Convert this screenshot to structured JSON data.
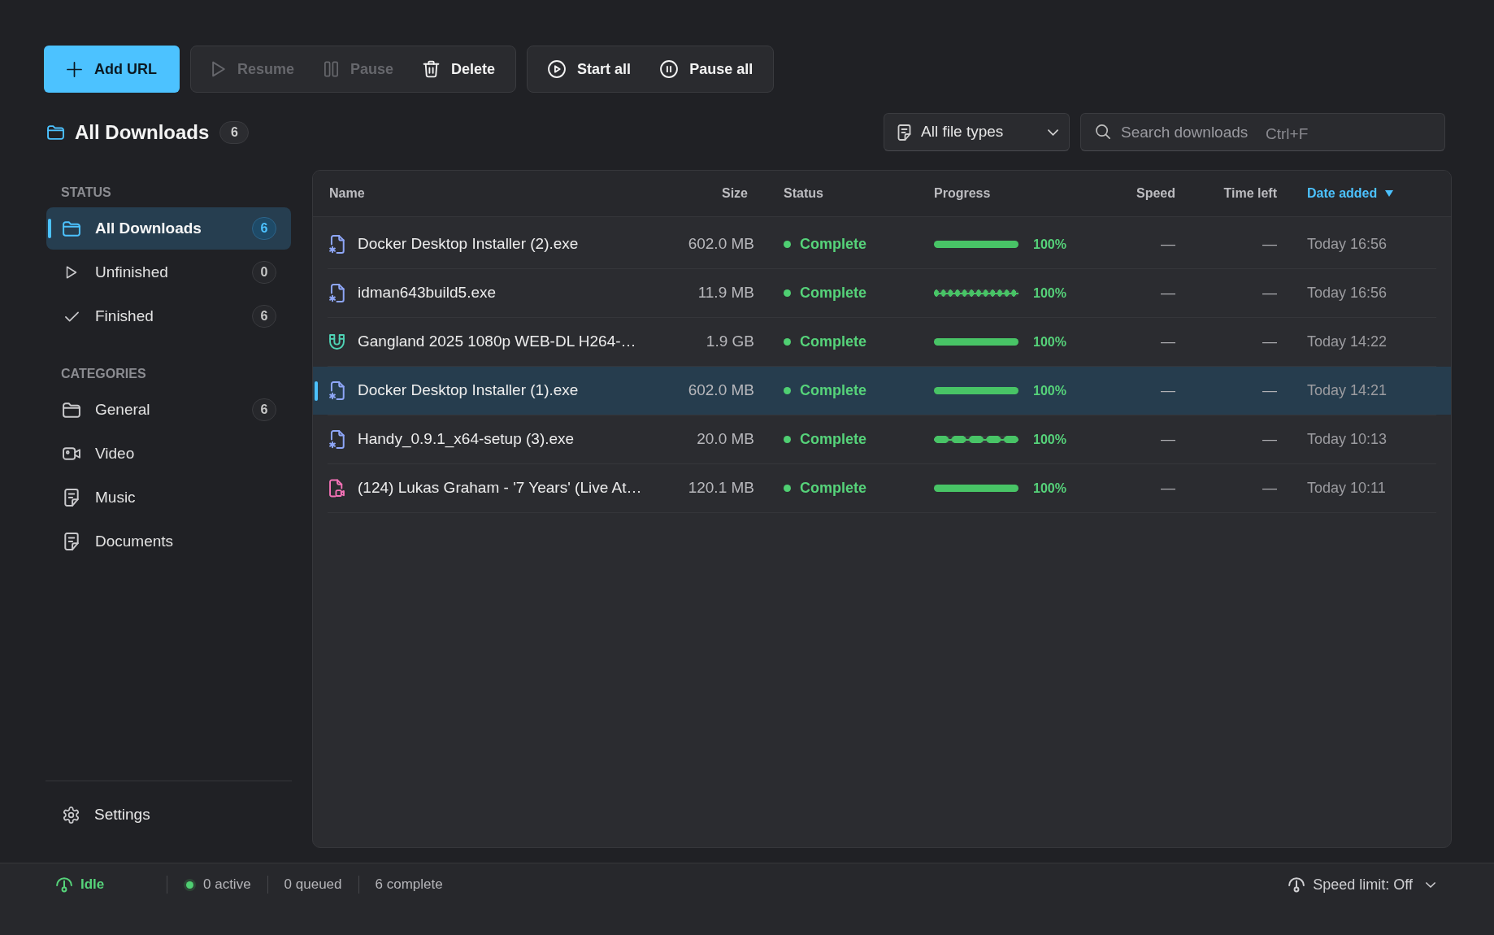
{
  "toolbar": {
    "add_button": {
      "label": "Add URL"
    },
    "groups": [
      [
        {
          "kind": "resume",
          "label": "Resume",
          "disabled": true
        },
        {
          "kind": "pause",
          "label": "Pause",
          "disabled": true
        },
        {
          "kind": "delete",
          "label": "Delete",
          "disabled": false
        }
      ],
      [
        {
          "kind": "start_all",
          "label": "Start all",
          "disabled": false
        },
        {
          "kind": "pause_all",
          "label": "Pause all",
          "disabled": false
        }
      ]
    ]
  },
  "header": {
    "title": "All Downloads",
    "count": "6"
  },
  "filter": {
    "value": "All file types"
  },
  "search": {
    "placeholder": "Search downloads",
    "shortcut": "Ctrl+F"
  },
  "sidebar": {
    "sections": [
      {
        "title": "STATUS",
        "items": [
          {
            "kind": "all",
            "label": "All Downloads",
            "count": "6",
            "selected": true
          },
          {
            "kind": "unfinished",
            "label": "Unfinished",
            "count": "0",
            "selected": false
          },
          {
            "kind": "finished",
            "label": "Finished",
            "count": "6",
            "selected": false
          }
        ]
      },
      {
        "title": "CATEGORIES",
        "items": [
          {
            "kind": "folder",
            "label": "General",
            "count": "6",
            "selected": false
          },
          {
            "kind": "video",
            "label": "Video",
            "selected": false
          },
          {
            "kind": "music",
            "label": "Music",
            "selected": false
          },
          {
            "kind": "documents",
            "label": "Documents",
            "selected": false
          }
        ]
      }
    ],
    "settings": {
      "label": "Settings"
    }
  },
  "table": {
    "columns": [
      {
        "label": "Name",
        "sorted": false
      },
      {
        "label": "Size",
        "sorted": false
      },
      {
        "label": "Status",
        "sorted": false
      },
      {
        "label": "Progress",
        "sorted": false
      },
      {
        "label": "Speed",
        "sorted": false
      },
      {
        "label": "Time left",
        "sorted": false
      },
      {
        "label": "Date added",
        "sorted": true
      }
    ],
    "rows": [
      {
        "kind": "program",
        "name": "Docker Desktop Installer (2).exe",
        "size": "602.0 MB",
        "status": "Complete",
        "progress": {
          "kind": "solid",
          "level": 1,
          "percent": "100%"
        },
        "speed": "—",
        "time_left": "—",
        "date_added": "Today 16:56",
        "selected": false
      },
      {
        "kind": "program",
        "name": "idman643build5.exe",
        "size": "11.9 MB",
        "status": "Complete",
        "progress": {
          "kind": "dots",
          "level": 1,
          "percent": "100%"
        },
        "speed": "—",
        "time_left": "—",
        "date_added": "Today 16:56",
        "selected": false
      },
      {
        "kind": "torrent",
        "name": "Gangland 2025 1080p WEB-DL H264-…",
        "size": "1.9 GB",
        "status": "Complete",
        "progress": {
          "kind": "solid",
          "level": 1,
          "percent": "100%"
        },
        "speed": "—",
        "time_left": "—",
        "date_added": "Today 14:22",
        "selected": false
      },
      {
        "kind": "program",
        "name": "Docker Desktop Installer (1).exe",
        "size": "602.0 MB",
        "status": "Complete",
        "progress": {
          "kind": "solid",
          "level": 1,
          "percent": "100%"
        },
        "speed": "—",
        "time_left": "—",
        "date_added": "Today 14:21",
        "selected": true
      },
      {
        "kind": "program",
        "name": "Handy_0.9.1_x64-setup (3).exe",
        "size": "20.0 MB",
        "status": "Complete",
        "progress": {
          "kind": "segments",
          "level": 1,
          "percent": "100%"
        },
        "speed": "—",
        "time_left": "—",
        "date_added": "Today 10:13",
        "selected": false
      },
      {
        "kind": "media",
        "name": "(124) Lukas Graham - '7 Years' (Live At…",
        "size": "120.1 MB",
        "status": "Complete",
        "progress": {
          "kind": "solid",
          "level": 1,
          "percent": "100%"
        },
        "speed": "—",
        "time_left": "—",
        "date_added": "Today 10:11",
        "selected": false
      }
    ]
  },
  "status_bar": {
    "state": "Idle",
    "active": "0 active",
    "queued": "0 queued",
    "complete": "6 complete",
    "speed_limit": "Speed limit: Off"
  }
}
